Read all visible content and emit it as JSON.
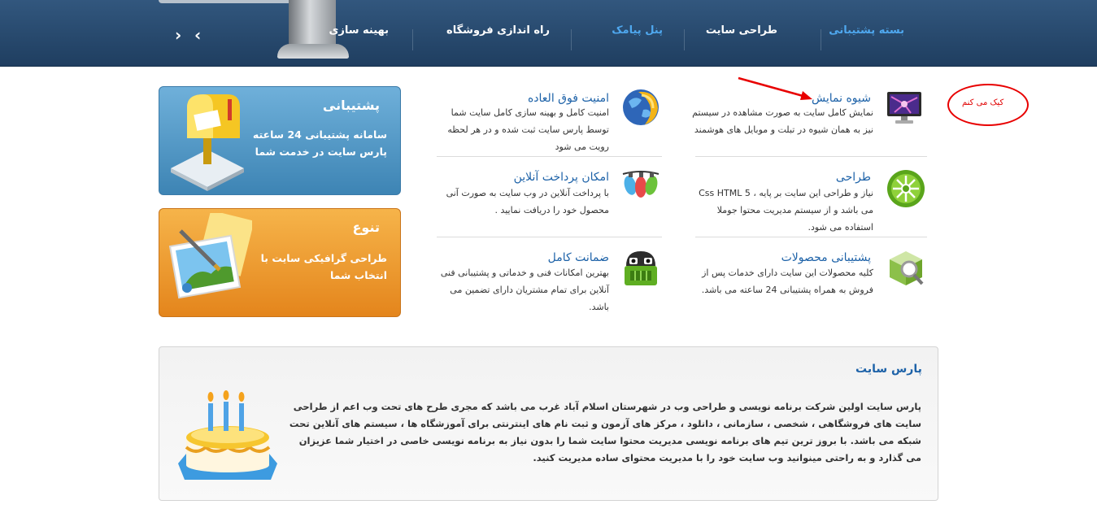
{
  "nav": {
    "items": [
      "بسته پشتیبانی",
      "طراحی سایت",
      "پنل پیامک",
      "راه اندازی فروشگاه",
      "بهینه سازی"
    ]
  },
  "annotation": {
    "text": "کیک می کنم"
  },
  "features": [
    {
      "title": "شیوه نمایش",
      "desc": "نمایش کامل سایت به صورت مشاهده در سیستم نیز به همان شیوه در تبلت و موبایل های هوشمند",
      "icon": "monitor-icon"
    },
    {
      "title": "طراحی",
      "desc": "نیاز و طراحی این سایت بر پایه ، Css HTML 5 می باشد و از سیستم مدیریت محتوا جوملا استفاده می شود.",
      "icon": "green-wheel-icon"
    },
    {
      "title": "پشتیبانی محصولات",
      "desc": "کلیه محصولات این سایت دارای خدمات پس از فروش به همراه پشتیبانی 24 ساعته می باشد.",
      "icon": "magnifier-box-icon"
    },
    {
      "title": "امنیت فوق العاده",
      "desc": "امنیت کامل و بهینه سازی کامل سایت شما توسط پارس سایت ثبت شده و در هر لحظه رویت می شود",
      "icon": "globe-shield-icon"
    },
    {
      "title": "امکان پرداخت آنلاین",
      "desc": "با پرداخت آنلاین در وب سایت به صورت آنی محصول خود را دریافت نمایید .",
      "icon": "lights-icon"
    },
    {
      "title": "ضمانت کامل",
      "desc": "بهترین امکانات فنی و خدماتی و پشتیبانی فنی آنلاین برای تمام مشتریان دارای تضمین  می باشد.",
      "icon": "robot-icon"
    }
  ],
  "support_box": {
    "title": "پشتیبانی",
    "text": "سامانه پشتیبانی 24 ساعته پارس سایت در خدمت شما",
    "color": "#4f97c4"
  },
  "variety_box": {
    "title": "تنوع",
    "text": "طراحی گرافیکی سایت با انتخاب شما",
    "color": "#f09a2c"
  },
  "about": {
    "title": "پارس سایت",
    "text": "پارس سایت اولین شرکت برنامه نویسی و طراحی وب در شهرستان اسلام آباد غرب می باشد که مجری طرح های تحت وب اعم از طراحی سایت های فروشگاهی ، شخصی ، سازمانی ، دانلود ، مرکز های آزمون و ثبت نام های اینترنتی برای آموزشگاه ها ، سیستم های آنلاین تحت شبکه می باشد. با بروز ترین تیم های برنامه نویسی مدیریت محتوا سایت شما را بدون نیاز به برنامه نویسی خاصی در اختیار شما عزیزان می گذارد و به راحتی مینوانید وب سایت خود را با مدیریت محتوای ساده مدیریت کنید."
  }
}
